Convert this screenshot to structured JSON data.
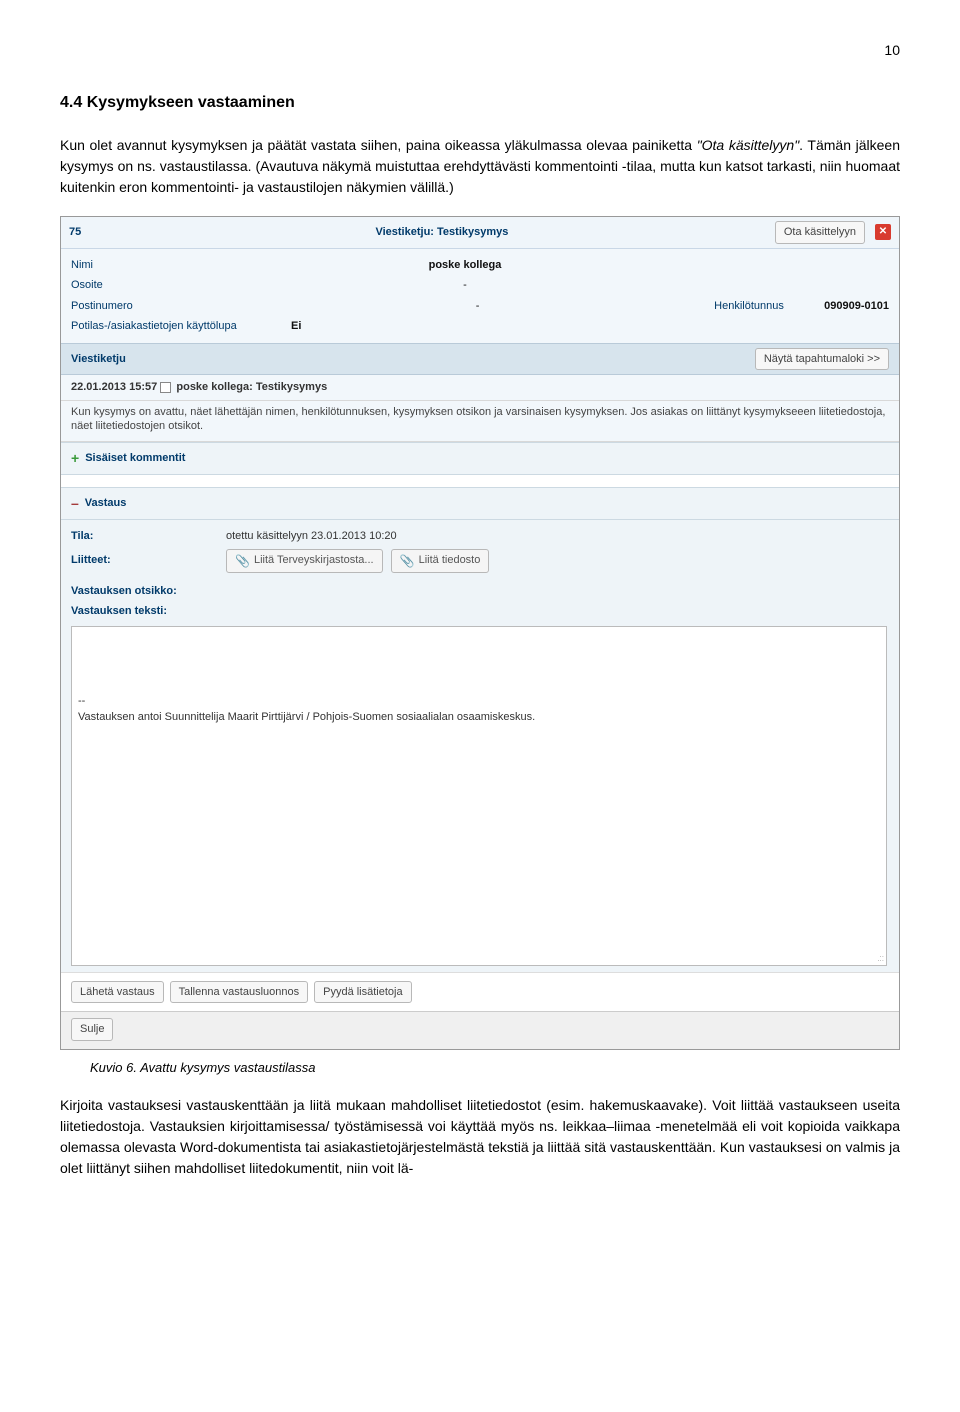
{
  "page_number": "10",
  "heading": "4.4  Kysymykseen vastaaminen",
  "intro": {
    "line1a": "Kun olet avannut kysymyksen ja päätät vastata siihen, paina oikeassa yläkulmassa olevaa painiketta ",
    "quote": "\"Ota käsittelyyn\"",
    "line1b": ". Tämän jälkeen kysymys on ns. vastaustilassa. (Avautuva näkymä muistuttaa erehdyttävästi kommentointi -tilaa, mutta kun katsot tarkasti, niin huomaat kuitenkin eron kommentointi- ja vastaustilojen näkymien välillä.)"
  },
  "shot": {
    "thread_num": "75",
    "thread_label": "Viestiketju: ",
    "thread_title": "Testikysymys",
    "take_btn": "Ota käsittelyyn",
    "fields": {
      "name_label": "Nimi",
      "name_val": "poske kollega",
      "addr_label": "Osoite",
      "addr_val": "-",
      "zip_label": "Postinumero",
      "zip_val": "-",
      "ssn_label": "Henkilötunnus",
      "ssn_val": "090909-0101",
      "perm_label": "Potilas-/asiakastietojen käyttölupa",
      "perm_val": "Ei"
    },
    "viestiketju": "Viestiketju",
    "log_btn": "Näytä tapahtumaloki >>",
    "msg_head": "22.01.2013 15:57",
    "msg_author": "poske kollega: Testikysymys",
    "msg_body": "Kun kysymys on avattu, näet lähettäjän nimen, henkilötunnuksen, kysymyksen otsikon ja varsinaisen kysymyksen. Jos asiakas on liittänyt kysymykseeen liitetiedostoja, näet liitetiedostojen otsikot.",
    "comments": "Sisäiset kommentit",
    "vastaus": "Vastaus",
    "tila_label": "Tila:",
    "tila_val": "otettu käsittelyyn 23.01.2013 10:20",
    "liitteet_label": "Liitteet:",
    "attach1": "Liitä Terveyskirjastosta...",
    "attach2": "Liitä tiedosto",
    "otsikko_label": "Vastauksen otsikko:",
    "teksti_label": "Vastauksen teksti:",
    "signature": "--\nVastauksen antoi Suunnittelija Maarit Pirttijärvi / Pohjois-Suomen sosiaalialan osaamiskeskus.",
    "send": "Lähetä vastaus",
    "save": "Tallenna vastausluonnos",
    "ask_more": "Pyydä lisätietoja",
    "close": "Sulje"
  },
  "caption": "Kuvio 6. Avattu kysymys vastaustilassa",
  "after": "Kirjoita vastauksesi vastauskenttään ja liitä mukaan mahdolliset liitetiedostot (esim. hakemuskaavake). Voit liittää vastaukseen useita liitetiedostoja. Vastauksien kirjoittamisessa/ työstämisessä voi käyttää myös ns. leikkaa–liimaa -menetelmää eli voit kopioida vaikkapa olemassa olevasta Word-dokumentista tai asiakastietojärjestelmästä tekstiä ja liittää sitä vastauskenttään. Kun vastauksesi on valmis ja olet liittänyt siihen mahdolliset liitedokumentit, niin voit lä-"
}
